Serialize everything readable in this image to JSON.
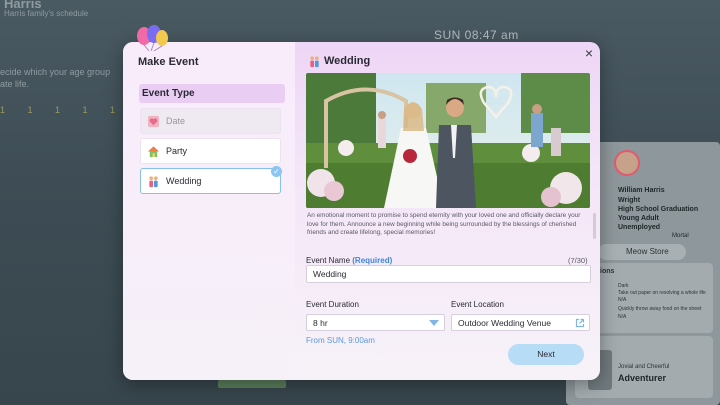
{
  "background": {
    "title": "Harris",
    "subtitle": "Harris family's schedule",
    "line1": "ecide which your age group",
    "line2": "ate life.",
    "dots": "1  1  1  1  1",
    "clock": "SUN  08:47 am",
    "profile": {
      "name": "William Harris",
      "lines": [
        "Wright",
        "High School Graduation",
        "Young Adult",
        "Unemployed"
      ],
      "traits_note": "Mortal"
    },
    "store_label": "Meow Store",
    "card_section": "ions",
    "card_items": [
      "Dark",
      "Take out paper on resolving a whole life",
      "N/A",
      "Quickly throw away food on the street",
      "N/A"
    ],
    "card_sub": "Jovial and Cheerful",
    "card_title": "Adventurer"
  },
  "modal": {
    "title": "Make Event",
    "section_title": "Event Type",
    "event_types": [
      {
        "label": "Date",
        "state": "disabled",
        "icon": "heart-icon"
      },
      {
        "label": "Party",
        "state": "normal",
        "icon": "house-icon"
      },
      {
        "label": "Wedding",
        "state": "selected",
        "icon": "couple-icon"
      }
    ],
    "detail_title": "Wedding",
    "description": "An emotional moment to promise to spend eternity with your loved one and officially declare your love for them. Announce a new beginning while being surrounded by the blessings of cherished friends and create lifelong, special memories!",
    "event_name_label": "Event Name",
    "event_name_required": "(Required)",
    "event_name_counter": "(7/30)",
    "event_name_value": "Wedding",
    "duration_label": "Event Duration",
    "duration_value": "8 hr",
    "location_label": "Event Location",
    "location_value": "Outdoor Wedding Venue",
    "from_note": "From SUN, 9:00am",
    "next_label": "Next",
    "close_symbol": "×"
  },
  "colors": {
    "accent_blue": "#3e86d6",
    "next_button": "#b7dcf6",
    "selected_border": "#86bff0",
    "section_bg": "#e9cdf3"
  }
}
